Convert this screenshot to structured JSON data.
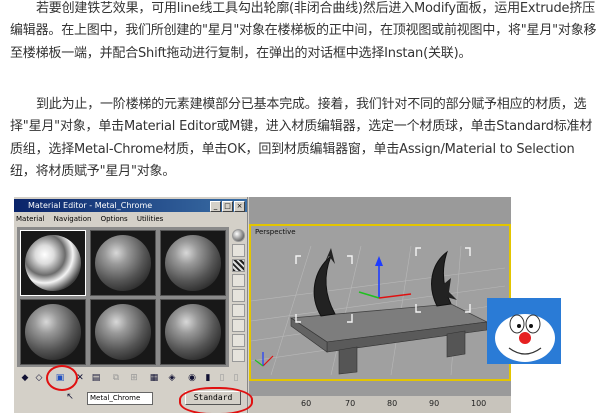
{
  "article": {
    "para1": "若要创建铁艺效果，可用line线工具勾出轮廓(非闭合曲线)然后进入Modify面板，运用Extrude挤压编辑器。在上图中，我们所创建的\"星月\"对象在楼梯板的正中间，在顶视图或前视图中，将\"星月\"对象移至楼梯板一端，并配合Shift拖动进行复制，在弹出的对话框中选择Instan(关联)。",
    "para2": "到此为止，一阶楼梯的元素建模部分已基本完成。接着，我们针对不同的部分赋予相应的材质，选择\"星月\"对象，单击Material Editor或M键，进入材质编辑器，选定一个材质球，单击Standard标准材质组，选择Metal-Chrome材质，单击OK，回到材质编辑器窗，单击Assign/Material to Selection纽，将材质赋予\"星月\"对象。"
  },
  "material_editor": {
    "title": "Material Editor - Metal_Chrome",
    "menu": [
      "Material",
      "Navigation",
      "Options",
      "Utilities"
    ],
    "material_name": "Metal_Chrome",
    "type_button": "Standard",
    "title_buttons": [
      "_",
      "□",
      "×"
    ]
  },
  "viewport": {
    "label": "Perspective",
    "ruler_ticks": [
      "60",
      "70",
      "80",
      "90",
      "100"
    ]
  },
  "colors": {
    "annotation": "#e01010",
    "viewport_border": "#e3c500",
    "title_bar": "#0a246a"
  },
  "icons": [
    "material-sphere-icon",
    "assign-material-icon",
    "delete-icon",
    "pick-material-icon",
    "cat-icon"
  ]
}
